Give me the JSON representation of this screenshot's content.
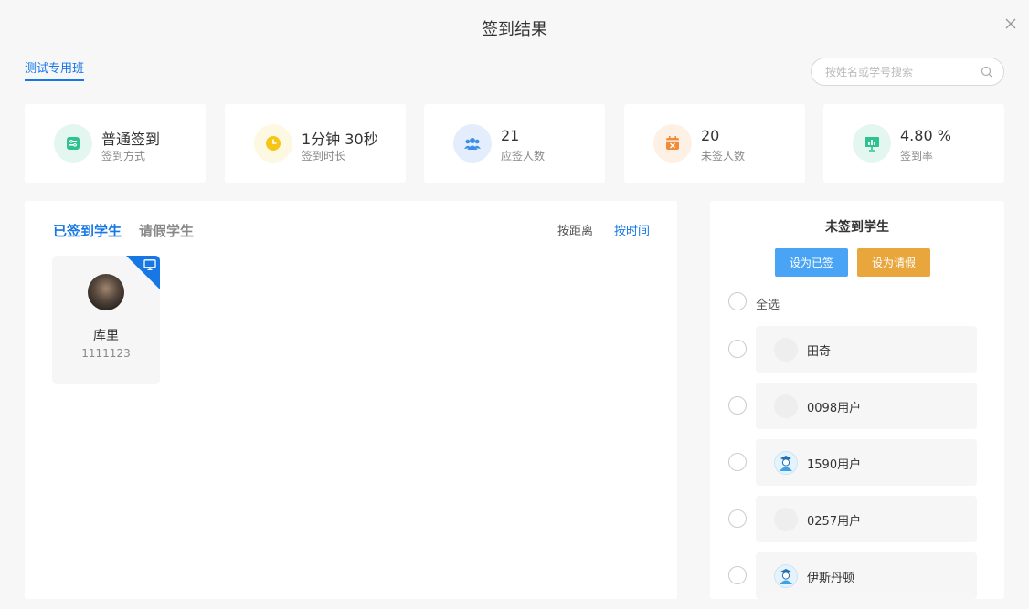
{
  "dialog": {
    "title": "签到结果",
    "class_tab": "测试专用班",
    "search_placeholder": "按姓名或学号搜索"
  },
  "stats": [
    {
      "value": "普通签到",
      "label": "签到方式",
      "icon": "checkin-mode-icon",
      "color": "#2ec28e"
    },
    {
      "value": "1分钟 30秒",
      "label": "签到时长",
      "icon": "clock-icon",
      "color": "#f5c518"
    },
    {
      "value": "21",
      "label": "应签人数",
      "icon": "group-icon",
      "color": "#3d8ee8"
    },
    {
      "value": "20",
      "label": "未签人数",
      "icon": "calendar-x-icon",
      "color": "#f08b3a"
    },
    {
      "value": "4.80 %",
      "label": "签到率",
      "icon": "chart-board-icon",
      "color": "#2ec28e"
    }
  ],
  "left_panel": {
    "tabs": [
      "已签到学生",
      "请假学生"
    ],
    "sort_options": [
      "按距离",
      "按时间"
    ],
    "students": [
      {
        "name": "库里",
        "id": "1111123"
      }
    ]
  },
  "right_panel": {
    "title": "未签到学生",
    "btn_signed": "设为已签",
    "btn_leave": "设为请假",
    "select_all": "全选",
    "students": [
      {
        "name": "田奇",
        "avatar": "placeholder"
      },
      {
        "name": "0098用户",
        "avatar": "placeholder"
      },
      {
        "name": "1590用户",
        "avatar": "student"
      },
      {
        "name": "0257用户",
        "avatar": "placeholder"
      },
      {
        "name": "伊斯丹顿",
        "avatar": "student"
      }
    ]
  },
  "colors": {
    "accent": "#1677e5",
    "sign_button": "#4aa4f5",
    "leave_button": "#e8a63c"
  }
}
